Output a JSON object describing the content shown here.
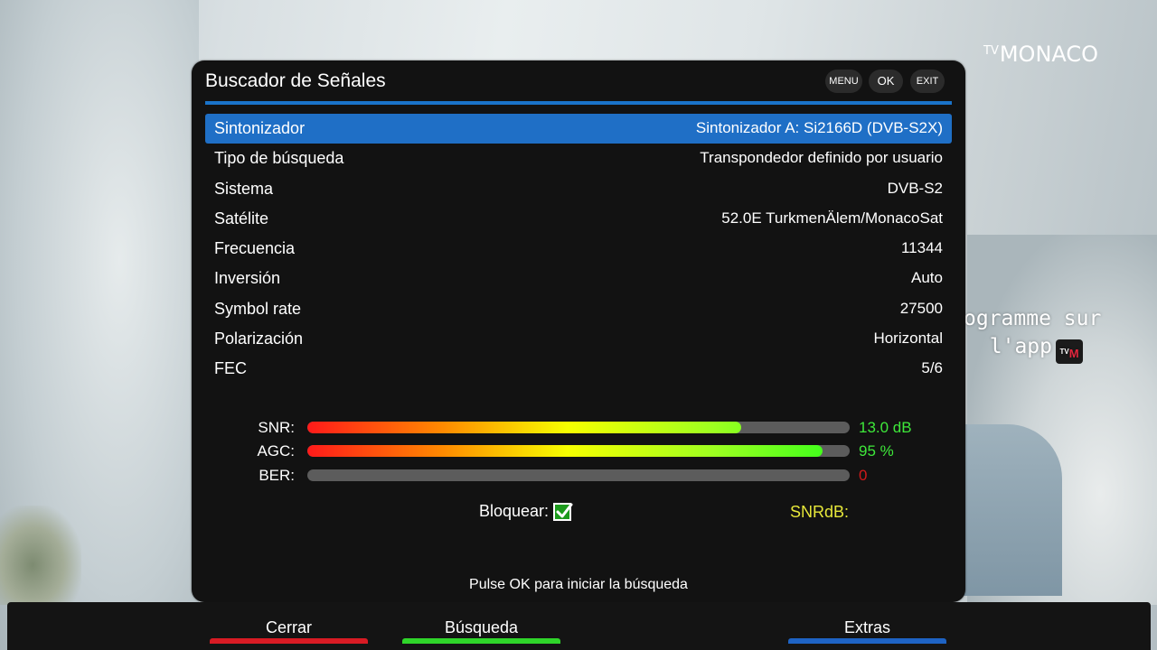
{
  "brand": {
    "tv": "TV",
    "name": "MONACO"
  },
  "promo": {
    "line1": "ogramme sur",
    "line2": "l'app",
    "logo_tv": "TV",
    "logo_m": "M"
  },
  "dialog": {
    "title": "Buscador de Señales",
    "keys": {
      "menu": "MENU",
      "ok": "OK",
      "exit": "EXIT"
    },
    "rows": [
      {
        "label": "Sintonizador",
        "value": "Sintonizador A: Si2166D (DVB-S2X)",
        "selected": true
      },
      {
        "label": "Tipo de búsqueda",
        "value": "Transpondedor definido por usuario",
        "selected": false
      },
      {
        "label": "Sistema",
        "value": "DVB-S2",
        "selected": false
      },
      {
        "label": "Satélite",
        "value": "52.0E TurkmenÄlem/MonacoSat",
        "selected": false
      },
      {
        "label": "Frecuencia",
        "value": "11344",
        "selected": false
      },
      {
        "label": "Inversión",
        "value": "Auto",
        "selected": false
      },
      {
        "label": "Symbol rate",
        "value": "27500",
        "selected": false
      },
      {
        "label": "Polarización",
        "value": "Horizontal",
        "selected": false
      },
      {
        "label": "FEC",
        "value": "5/6",
        "selected": false
      }
    ],
    "meters": {
      "snr": {
        "label": "SNR:",
        "value_text": "13.0 dB",
        "fill_percent": 80,
        "value_color": "#3ee83a"
      },
      "agc": {
        "label": "AGC:",
        "value_text": "95 %",
        "fill_percent": 95,
        "value_color": "#3ee83a"
      },
      "ber": {
        "label": "BER:",
        "value_text": "0",
        "fill_percent": 0,
        "value_color": "#d01a1a"
      }
    },
    "lock_label": "Bloquear:",
    "lock_checked": true,
    "snrdb_label": "SNRdB:",
    "hint": "Pulse OK para iniciar la búsqueda"
  },
  "function_keys": [
    {
      "label": "Cerrar",
      "color": "#d81b24"
    },
    {
      "label": "Búsqueda",
      "color": "#2fd52a"
    },
    {
      "label": "Extras",
      "color": "#1e63c4"
    }
  ],
  "colors": {
    "accent": "#1a73c9",
    "selected_row": "#1f6fc6",
    "panel_bg": "#121212",
    "snrdb": "#e7e83a"
  }
}
